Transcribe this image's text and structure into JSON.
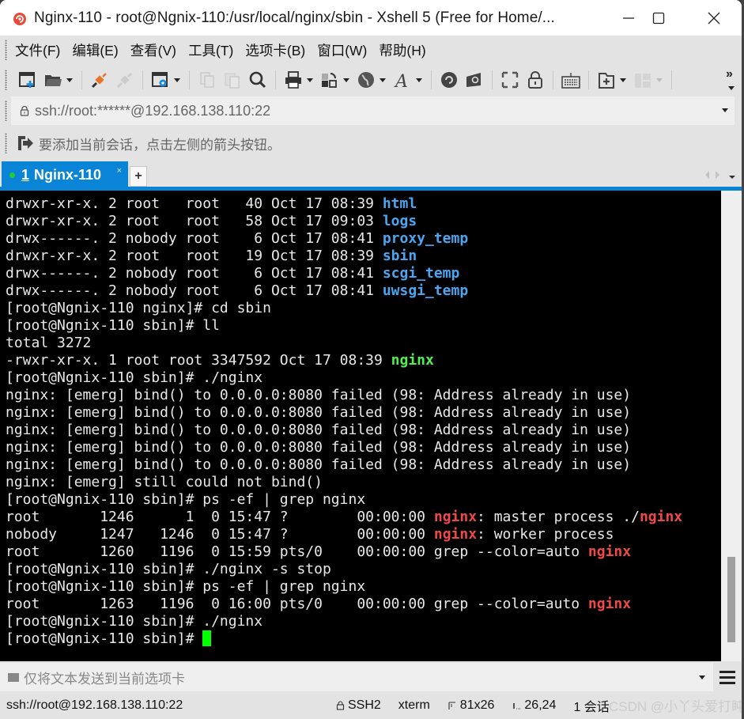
{
  "window": {
    "title": "Nginx-110 - root@Ngnix-110:/usr/local/nginx/sbin - Xshell 5 (Free for Home/...",
    "minimize_label": "—",
    "close_label": "✕"
  },
  "menu": {
    "items": [
      "文件(F)",
      "编辑(E)",
      "查看(V)",
      "工具(T)",
      "选项卡(B)",
      "窗口(W)",
      "帮助(H)"
    ]
  },
  "toolbar": {
    "icons": [
      "new-session",
      "open-folder",
      "connect",
      "disconnect",
      "properties",
      "copy",
      "paste",
      "find",
      "print",
      "transfer",
      "globe",
      "font",
      "xshell",
      "xftp",
      "fullscreen",
      "lock",
      "keyboard",
      "add-compose",
      "layout",
      "more"
    ],
    "overflow_label": "»"
  },
  "address": {
    "value": "ssh://root:******@192.168.138.110:22"
  },
  "hint": {
    "text": "要添加当前会话，点击左侧的箭头按钮。"
  },
  "tabs": [
    {
      "number": "1",
      "label": "Nginx-110",
      "status_color": "#22cc33",
      "close": "×"
    }
  ],
  "tab_add_label": "+",
  "terminal": {
    "lines": [
      [
        {
          "t": "drwxr-xr-x. 2 root   root   40 Oct 17 08:39 "
        },
        {
          "t": "html",
          "c": "blue"
        }
      ],
      [
        {
          "t": "drwxr-xr-x. 2 root   root   58 Oct 17 09:03 "
        },
        {
          "t": "logs",
          "c": "blue"
        }
      ],
      [
        {
          "t": "drwx------. 2 nobody root    6 Oct 17 08:41 "
        },
        {
          "t": "proxy_temp",
          "c": "blue"
        }
      ],
      [
        {
          "t": "drwxr-xr-x. 2 root   root   19 Oct 17 08:39 "
        },
        {
          "t": "sbin",
          "c": "blue"
        }
      ],
      [
        {
          "t": "drwx------. 2 nobody root    6 Oct 17 08:41 "
        },
        {
          "t": "scgi_temp",
          "c": "blue"
        }
      ],
      [
        {
          "t": "drwx------. 2 nobody root    6 Oct 17 08:41 "
        },
        {
          "t": "uwsgi_temp",
          "c": "blue"
        }
      ],
      [
        {
          "t": "[root@Ngnix-110 nginx]# cd sbin"
        }
      ],
      [
        {
          "t": "[root@Ngnix-110 sbin]# ll"
        }
      ],
      [
        {
          "t": "total 3272"
        }
      ],
      [
        {
          "t": "-rwxr-xr-x. 1 root root 3347592 Oct 17 08:39 "
        },
        {
          "t": "nginx",
          "c": "green"
        }
      ],
      [
        {
          "t": "[root@Ngnix-110 sbin]# ./nginx"
        }
      ],
      [
        {
          "t": "nginx: [emerg] bind() to 0.0.0.0:8080 failed (98: Address already in use)"
        }
      ],
      [
        {
          "t": "nginx: [emerg] bind() to 0.0.0.0:8080 failed (98: Address already in use)"
        }
      ],
      [
        {
          "t": "nginx: [emerg] bind() to 0.0.0.0:8080 failed (98: Address already in use)"
        }
      ],
      [
        {
          "t": "nginx: [emerg] bind() to 0.0.0.0:8080 failed (98: Address already in use)"
        }
      ],
      [
        {
          "t": "nginx: [emerg] bind() to 0.0.0.0:8080 failed (98: Address already in use)"
        }
      ],
      [
        {
          "t": "nginx: [emerg] still could not bind()"
        }
      ],
      [
        {
          "t": "[root@Ngnix-110 sbin]# ps -ef | grep nginx"
        }
      ],
      [
        {
          "t": "root       1246      1  0 15:47 ?        00:00:00 "
        },
        {
          "t": "nginx",
          "c": "red"
        },
        {
          "t": ": master process ./"
        },
        {
          "t": "nginx",
          "c": "red"
        }
      ],
      [
        {
          "t": "nobody     1247   1246  0 15:47 ?        00:00:00 "
        },
        {
          "t": "nginx",
          "c": "red"
        },
        {
          "t": ": worker process"
        }
      ],
      [
        {
          "t": "root       1260   1196  0 15:59 pts/0    00:00:00 grep --color=auto "
        },
        {
          "t": "nginx",
          "c": "red"
        }
      ],
      [
        {
          "t": "[root@Ngnix-110 sbin]# ./nginx -s stop"
        }
      ],
      [
        {
          "t": "[root@Ngnix-110 sbin]# ps -ef | grep nginx"
        }
      ],
      [
        {
          "t": "root       1263   1196  0 16:00 pts/0    00:00:00 grep --color=auto "
        },
        {
          "t": "nginx",
          "c": "red"
        }
      ],
      [
        {
          "t": "[root@Ngnix-110 sbin]# ./nginx"
        }
      ],
      [
        {
          "t": "[root@Ngnix-110 sbin]# "
        },
        {
          "cursor": true
        }
      ]
    ],
    "colors": {
      "blue": "#4aa6f0",
      "green": "#4ef04e",
      "red": "#f04848",
      "cursor": "#00ff00"
    }
  },
  "sendbar": {
    "placeholder": "仅将文本发送到当前选项卡"
  },
  "status": {
    "connection": "ssh://root@192.168.138.110:22",
    "protocol": "SSH2",
    "terminal_type": "xterm",
    "size": "81x26",
    "cursor_pos": "26,24",
    "sessions": "1 会话"
  },
  "watermark": "CSDN @小丫头爱打盹"
}
